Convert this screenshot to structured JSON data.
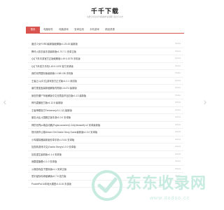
{
  "site": {
    "title": "千千下载",
    "subtitle": "免费分享安卓手游和软件资源网下载分享平台"
  },
  "nav": [
    {
      "label": "首页",
      "active": true
    },
    {
      "label": "电脑软件",
      "active": false
    },
    {
      "label": "电脑游戏",
      "active": false
    },
    {
      "label": "安卓应用",
      "active": false
    },
    {
      "label": "手机游戏",
      "active": false
    },
    {
      "label": "精品资源",
      "active": false
    }
  ],
  "list": [
    {
      "title": "魔法少女FORD最新版破解版v1.23.45 最新版",
      "date": "04-11"
    },
    {
      "title": "腾讯火影忍者手游最新版v1.70.7.1 安卓正版",
      "date": "04-11"
    },
    {
      "title": "QQ飞车手游官方正版破解版1.49.0.1078 手机版",
      "date": "04-11"
    },
    {
      "title": "QQ飞车官方手机1.49.0.1078 官方安卓版",
      "date": "04-11"
    },
    {
      "title": "我的世界国际版最新版1.1.58.138 手机版",
      "date": "04-11"
    },
    {
      "title": "王者云斗(中文)游戏官方正式版v1.0.1 测试版",
      "date": "04-11"
    },
    {
      "title": "暴打蛋宝宝最新破解版内购版1.8.474 最新版",
      "date": "04-11"
    },
    {
      "title": "疯狂的僵尸车破解版中文无限金币钻石版v1.13 最新版",
      "date": "04-11"
    },
    {
      "title": "神马直播官方版v1.12.8 最新版",
      "date": "04-11"
    },
    {
      "title": "王者荣耀官方Timiverse(v3.1.12) 最新版",
      "date": "04-11"
    },
    {
      "title": "朋友大乱斗国服正版手游v1.0.0 安卓版",
      "date": "04-11"
    },
    {
      "title": "神的世界pc端启动器(PojavLauncher)1.6.6(release5)-v2 安卓最新版",
      "date": "04-11"
    },
    {
      "title": "现代城市公路Desert Girl Desire Story Game最新版v1.0.0 安卓版",
      "date": "04-11"
    },
    {
      "title": "小鸡模拟器最新版安卓手机v1.5.61 安卓版",
      "date": "04-11"
    },
    {
      "title": "加查新游戏中文(Gacha Story)v1.0.0 安卓版",
      "date": "04-11"
    },
    {
      "title": "加查重生最新版v1.1.4 安卓版",
      "date": "04-11"
    },
    {
      "title": "我要直播看v1.1.0 安卓版",
      "date": "04-11"
    },
    {
      "title": "火爆游戏盒子国际版v1.1 安卓正版",
      "date": "04-11"
    },
    {
      "title": "寰宇星际传奇破解版v0.7.5 官方版",
      "date": "04-11"
    },
    {
      "title": "PocketPal AI本地大模型v1.8.15 手游版",
      "date": "04-11"
    }
  ],
  "watermark": {
    "text": "东东收录网",
    "url": "www.dodoo.cc",
    "color": "#c7ebe0"
  }
}
